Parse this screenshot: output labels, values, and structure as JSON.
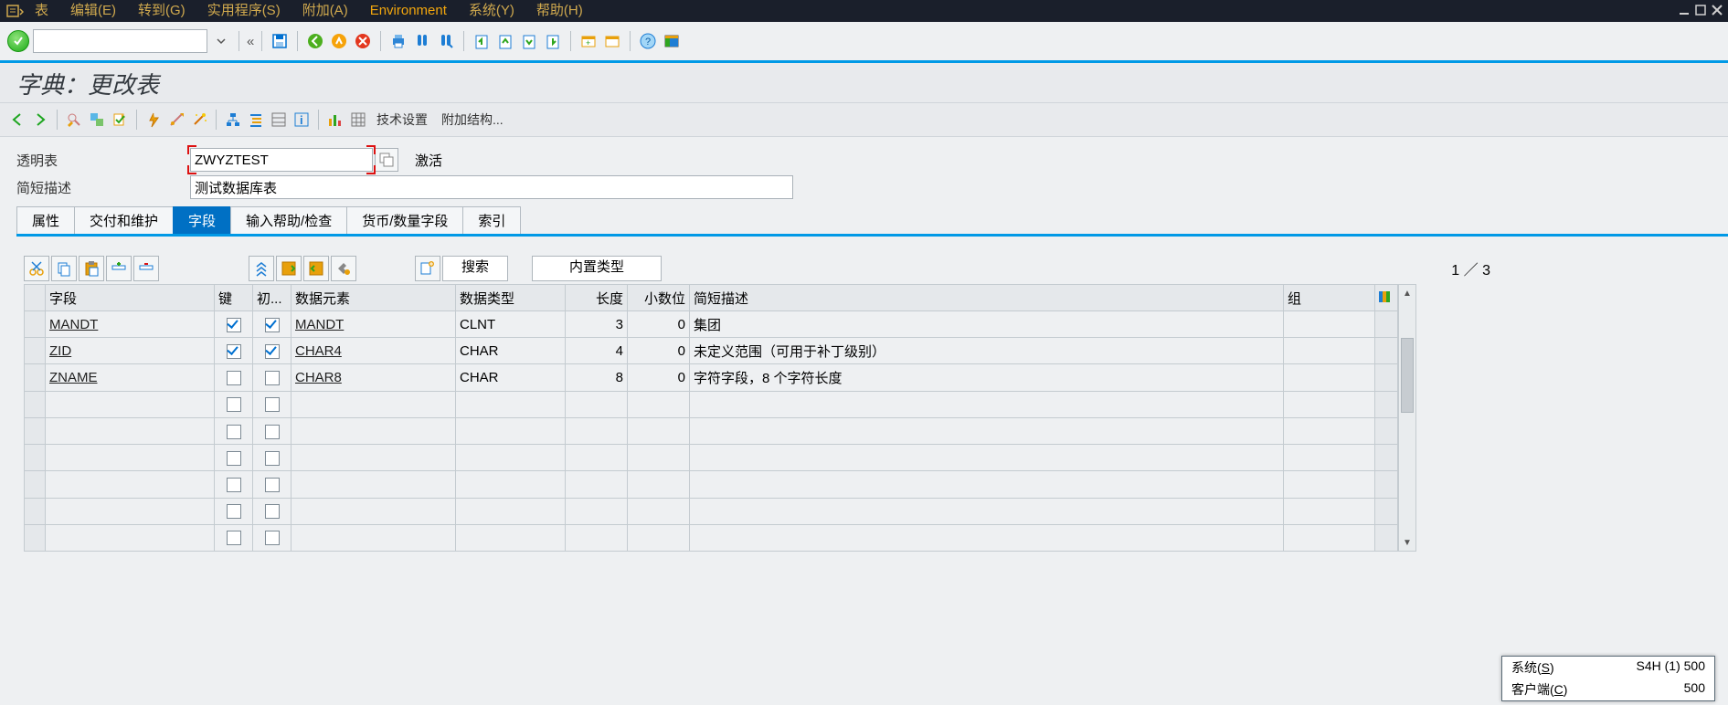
{
  "menu": {
    "table": "表",
    "edit": "编辑(E)",
    "goto": "转到(G)",
    "utils": "实用程序(S)",
    "extras": "附加(A)",
    "environment": "Environment",
    "system": "系统(Y)",
    "help": "帮助(H)"
  },
  "screen_title": "字典：更改表",
  "apptoolbar": {
    "techsettings": "技术设置",
    "appendstruct": "附加结构..."
  },
  "form": {
    "l_transp_table": "透明表",
    "table_name": "ZWYZTEST",
    "status": "激活",
    "l_short_desc": "简短描述",
    "short_desc": "测试数据库表"
  },
  "tabs": {
    "attributes": "属性",
    "delivery": "交付和维护",
    "fields": "字段",
    "inputhelp": "输入帮助/检查",
    "currquan": "货币/数量字段",
    "indexes": "索引"
  },
  "gridbar": {
    "search": "搜索",
    "builtin": "内置类型",
    "page_indicator": "1 ／ 3"
  },
  "columns": {
    "field": "字段",
    "key": "键",
    "init": "初...",
    "dataelem": "数据元素",
    "datatype": "数据类型",
    "length": "长度",
    "decimals": "小数位",
    "shortdesc": "简短描述",
    "group": "组"
  },
  "rows": [
    {
      "field": "MANDT",
      "key": true,
      "init": true,
      "elem": "MANDT",
      "dtype": "CLNT",
      "len": "3",
      "dec": "0",
      "desc": "集团"
    },
    {
      "field": "ZID",
      "key": true,
      "init": true,
      "elem": "CHAR4",
      "dtype": "CHAR",
      "len": "4",
      "dec": "0",
      "desc": "未定义范围（可用于补丁级别）"
    },
    {
      "field": "ZNAME",
      "key": false,
      "init": false,
      "elem": "CHAR8",
      "dtype": "CHAR",
      "len": "8",
      "dec": "0",
      "desc": "字符字段，8 个字符长度"
    }
  ],
  "empty_row_count": 6,
  "popup": {
    "l_system": "系统(S)",
    "v_system": "S4H (1) 500",
    "l_client": "客户端(C)",
    "v_client": "500"
  }
}
